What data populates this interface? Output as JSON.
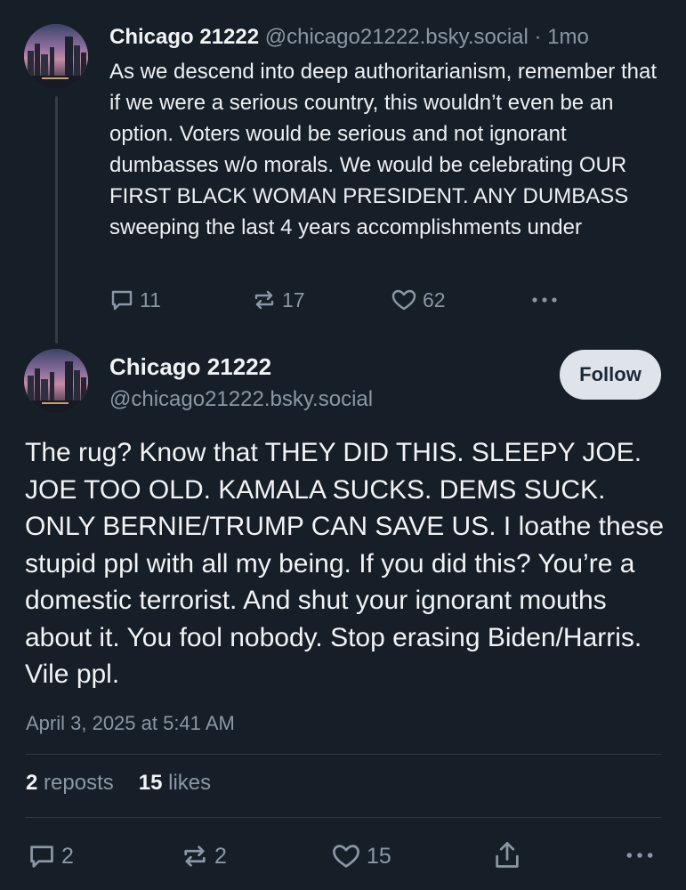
{
  "parent_post": {
    "author_name": "Chicago 21222",
    "handle": "@chicago21222.bsky.social",
    "separator": "·",
    "age": "1mo",
    "text": "As we descend into deep authoritarianism, remember that if we were a serious country, this wouldn’t even be an option. Voters would be serious and not ignorant dumbasses w/o morals. We would be celebrating OUR FIRST BLACK WOMAN PRESIDENT. ANY DUMBASS sweeping the last 4 years accomplishments under",
    "reply_count": "11",
    "repost_count": "17",
    "like_count": "62"
  },
  "main_post": {
    "author_name": "Chicago 21222",
    "handle": "@chicago21222.bsky.social",
    "follow_label": "Follow",
    "text": "The rug? Know that THEY DID THIS. SLEEPY JOE. JOE TOO OLD. KAMALA SUCKS. DEMS SUCK. ONLY BERNIE/TRUMP CAN SAVE US. I loathe these stupid ppl with all my being. If you did this? You’re a domestic terrorist. And shut your ignorant mouths about it. You fool nobody. Stop erasing Biden/Harris. Vile ppl.",
    "timestamp": "April 3, 2025 at 5:41 AM",
    "reposts_count": "2",
    "reposts_label": "reposts",
    "likes_count": "15",
    "likes_label": "likes",
    "reply_count": "2",
    "repost_count": "2",
    "like_count": "15"
  },
  "icons": [
    "reply-icon",
    "repost-icon",
    "like-icon",
    "share-icon",
    "more-icon"
  ],
  "colors": {
    "background": "#161e27",
    "muted": "#8a97a6",
    "follow_bg": "#dfe4ea"
  }
}
